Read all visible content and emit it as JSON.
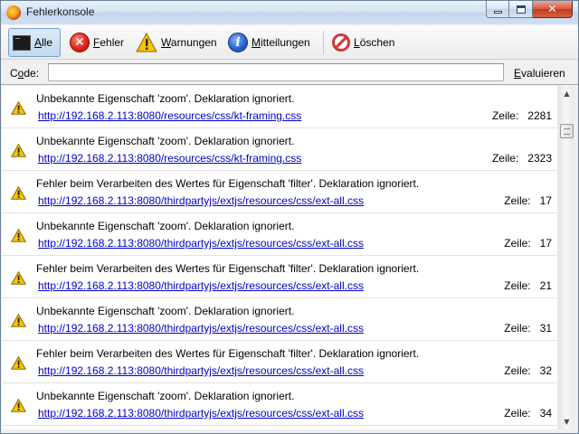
{
  "window": {
    "title": "Fehlerkonsole"
  },
  "toolbar": {
    "all": {
      "first": "A",
      "rest": "lle"
    },
    "errors": {
      "first": "F",
      "rest": "ehler"
    },
    "warnings": {
      "first": "W",
      "rest": "arnungen"
    },
    "messages": {
      "first": "M",
      "rest": "itteilungen"
    },
    "clear": {
      "first": "L",
      "rest": "öschen"
    }
  },
  "codebar": {
    "label_first": "o",
    "label_prefix": "C",
    "label_suffix": "de:",
    "input_value": "",
    "evaluate_first": "E",
    "evaluate_rest": "valuieren"
  },
  "line_label": "Zeile:",
  "icons": {
    "row": "warning-icon",
    "warning_color": "#f5c400"
  },
  "entries": [
    {
      "message": "Unbekannte Eigenschaft 'zoom'.  Deklaration ignoriert.",
      "url": "http://192.168.2.113:8080/resources/css/kt-framing.css",
      "line": "2281"
    },
    {
      "message": "Unbekannte Eigenschaft 'zoom'.  Deklaration ignoriert.",
      "url": "http://192.168.2.113:8080/resources/css/kt-framing.css",
      "line": "2323"
    },
    {
      "message": "Fehler beim Verarbeiten des Wertes für Eigenschaft 'filter'.  Deklaration ignoriert.",
      "url": "http://192.168.2.113:8080/thirdpartyjs/extjs/resources/css/ext-all.css",
      "line": "17"
    },
    {
      "message": "Unbekannte Eigenschaft 'zoom'.  Deklaration ignoriert.",
      "url": "http://192.168.2.113:8080/thirdpartyjs/extjs/resources/css/ext-all.css",
      "line": "17"
    },
    {
      "message": "Fehler beim Verarbeiten des Wertes für Eigenschaft 'filter'.  Deklaration ignoriert.",
      "url": "http://192.168.2.113:8080/thirdpartyjs/extjs/resources/css/ext-all.css",
      "line": "21"
    },
    {
      "message": "Unbekannte Eigenschaft 'zoom'.  Deklaration ignoriert.",
      "url": "http://192.168.2.113:8080/thirdpartyjs/extjs/resources/css/ext-all.css",
      "line": "31"
    },
    {
      "message": "Fehler beim Verarbeiten des Wertes für Eigenschaft 'filter'.  Deklaration ignoriert.",
      "url": "http://192.168.2.113:8080/thirdpartyjs/extjs/resources/css/ext-all.css",
      "line": "32"
    },
    {
      "message": "Unbekannte Eigenschaft 'zoom'.  Deklaration ignoriert.",
      "url": "http://192.168.2.113:8080/thirdpartyjs/extjs/resources/css/ext-all.css",
      "line": "34"
    }
  ]
}
